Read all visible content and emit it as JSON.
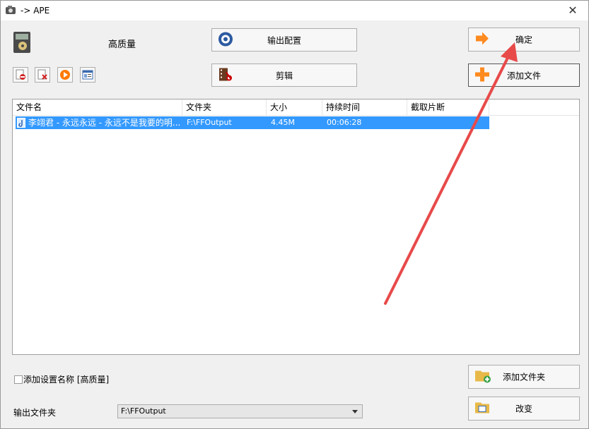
{
  "window": {
    "title": "-> APE",
    "close_symbol": "✕"
  },
  "profile": {
    "quality": "高质量"
  },
  "buttons": {
    "output_config": "输出配置",
    "confirm": "确定",
    "edit": "剪辑",
    "add_file": "添加文件",
    "add_folder": "添加文件夹",
    "change": "改变"
  },
  "table": {
    "columns": [
      "文件名",
      "文件夹",
      "大小",
      "持续时间",
      "截取片断"
    ],
    "rows": [
      {
        "name": "李翊君 - 永远永远 - 永远不是我要的明...",
        "folder": "F:\\FFOutput",
        "size": "4.45M",
        "duration": "00:06:28",
        "clip": ""
      }
    ]
  },
  "options": {
    "add_setting_name": "添加设置名称 [高质量]"
  },
  "output": {
    "label": "输出文件夹",
    "value": "F:\\FFOutput"
  },
  "colors": {
    "selection": "#3399ff",
    "arrow": "#e84a4a",
    "accent_orange": "#ff8a1f"
  }
}
